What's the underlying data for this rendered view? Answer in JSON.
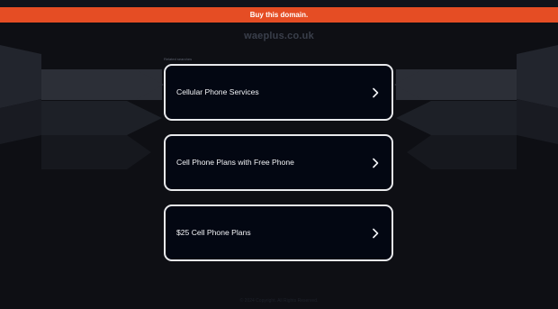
{
  "buy_bar": {
    "label": "Buy this domain."
  },
  "domain": {
    "name": "waeplus.co.uk"
  },
  "related": {
    "label": "Related searches",
    "items": [
      {
        "label": "Cellular Phone Services",
        "icon": "chevron-right-icon"
      },
      {
        "label": "Cell Phone Plans with Free Phone",
        "icon": "chevron-right-icon"
      },
      {
        "label": "$25 Cell Phone Plans",
        "icon": "chevron-right-icon"
      }
    ]
  },
  "footer": {
    "text": "© 2024 Copyright. All Rights Reserved."
  },
  "colors": {
    "background": "#0e0f14",
    "accent": "#e54d24",
    "card_border": "#e8e9ec",
    "card_fill": "#030712"
  }
}
